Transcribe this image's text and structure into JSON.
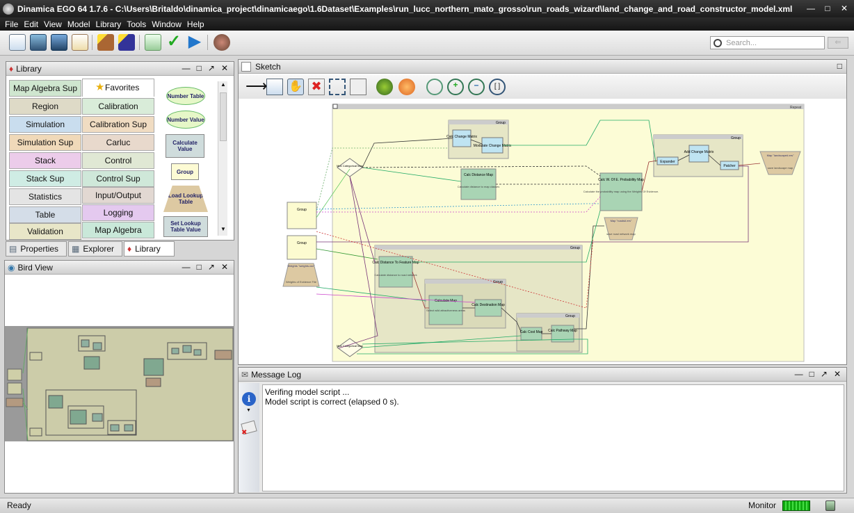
{
  "window": {
    "title": "Dinamica EGO 64 1.7.6 - C:\\Users\\Britaldo\\dinamica_project\\dinamicaego\\1.6Dataset\\Examples\\run_lucc_northern_mato_grosso\\run_roads_wizard\\land_change_and_road_constructor_model.xml"
  },
  "menu": [
    "File",
    "Edit",
    "View",
    "Model",
    "Library",
    "Tools",
    "Window",
    "Help"
  ],
  "search": {
    "placeholder": "Search..."
  },
  "library": {
    "title": "Library",
    "left_col": [
      "Map Algebra Sup",
      "Region",
      "Simulation",
      "Simulation Sup",
      "Stack",
      "Stack Sup",
      "Statistics",
      "Table",
      "Validation"
    ],
    "mid_col": [
      "Favorites",
      "Calibration",
      "Calibration Sup",
      "Carluc",
      "Control",
      "Control Sup",
      "Input/Output",
      "Logging",
      "Map Algebra"
    ],
    "functors": [
      "Number Table",
      "Number Value",
      "Calculate Value",
      "Group",
      "Load Lookup Table",
      "Set Lookup Table Value"
    ]
  },
  "tabs": [
    "Properties",
    "Explorer",
    "Library"
  ],
  "birdview": {
    "title": "Bird View"
  },
  "sketch": {
    "title": "Sketch",
    "repeat_label": "Repeat",
    "group_label": "Group",
    "nodes": {
      "calc_change_matrix": "Calc Change Matrix",
      "modulate_change_matrix": "Modulate Change Matrix",
      "calc_distance_map": "Calc Distance Map",
      "calc_distance_desc": "Calculate distance to map classes",
      "mux1": "Mux Categorical Map",
      "mux2": "Mux Categorical Map",
      "calc_woe": "Calc W. Of E. Probability Map",
      "calc_woe_desc": "Calculate the probability map using the Weights Of Evidence.",
      "expander": "Expander",
      "add_change_matrix": "Add Change Matrix",
      "patcher": "Patcher",
      "save_landscape": "Map \"landscape#.ers\"",
      "save_landscape_desc": "save landscape map",
      "save_roads": "Map \"roads#.ers\"",
      "save_roads_desc": "save road network map",
      "weights": "Weights \"weights.csv\"",
      "weights_desc": "Weights of Evidence File",
      "group_a": "Group",
      "group_b": "Group",
      "calc_dist_feature": "Calc Distance To Feature Map",
      "calc_dist_feature_desc": "Calculate distance to road network",
      "calculate_map": "Calculate Map",
      "calculate_map_desc": "Select wild attractiveness areas",
      "calc_destination": "Calc Destination Map",
      "calc_cost": "Calc Cost Map",
      "calc_pathway": "Calc Pathway Map"
    }
  },
  "messagelog": {
    "title": "Message Log",
    "lines": [
      "Verifing model script ...",
      "Model script is correct (elapsed 0 s)."
    ]
  },
  "status": {
    "left": "Ready",
    "monitor": "Monitor"
  }
}
